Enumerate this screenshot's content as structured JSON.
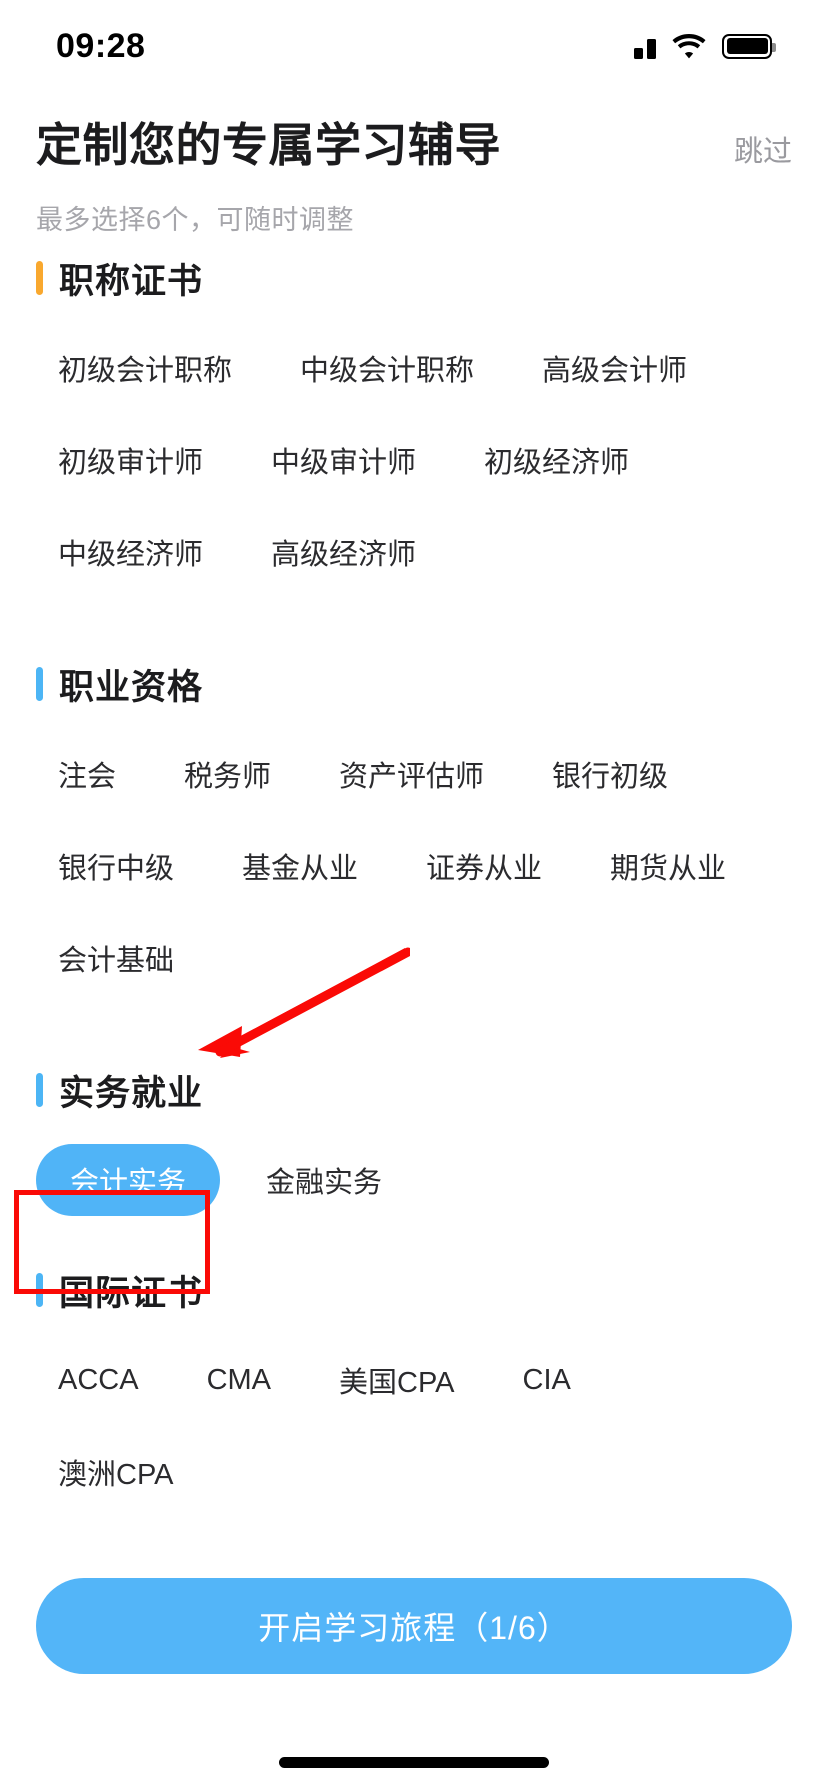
{
  "status_bar": {
    "time": "09:28",
    "signal_icon": "cellular-signal-icon",
    "wifi_icon": "wifi-icon",
    "battery_icon": "battery-full-icon"
  },
  "header": {
    "title": "定制您的专属学习辅导",
    "skip_label": "跳过",
    "subtitle": "最多选择6个，可随时调整"
  },
  "sections": [
    {
      "title": "职称证书",
      "accent_color": "#f9a82e",
      "chips": [
        "初级会计职称",
        "中级会计职称",
        "高级会计师",
        "初级审计师",
        "中级审计师",
        "初级经济师",
        "中级经济师",
        "高级经济师"
      ]
    },
    {
      "title": "职业资格",
      "accent_color": "#4cb5f5",
      "chips": [
        "注会",
        "税务师",
        "资产评估师",
        "银行初级",
        "银行中级",
        "基金从业",
        "证券从业",
        "期货从业",
        "会计基础"
      ]
    },
    {
      "title": "实务就业",
      "accent_color": "#4cb5f5",
      "chips": [
        "会计实务",
        "金融实务"
      ],
      "selected": [
        "会计实务"
      ]
    },
    {
      "title": "国际证书",
      "accent_color": "#4cb5f5",
      "chips": [
        "ACCA",
        "CMA",
        "美国CPA",
        "CIA",
        "澳洲CPA"
      ]
    }
  ],
  "cta": {
    "label": "开启学习旅程（1/6）",
    "color": "#53b5f8"
  },
  "annotations": {
    "highlight_color": "#fa0a06",
    "highlight_target": "会计实务",
    "arrow_icon": "arrow-pointing-icon"
  },
  "colors": {
    "selected_chip": "#50b4f7",
    "title_text": "#1c1c1e",
    "muted_text": "#a6a6ab"
  }
}
